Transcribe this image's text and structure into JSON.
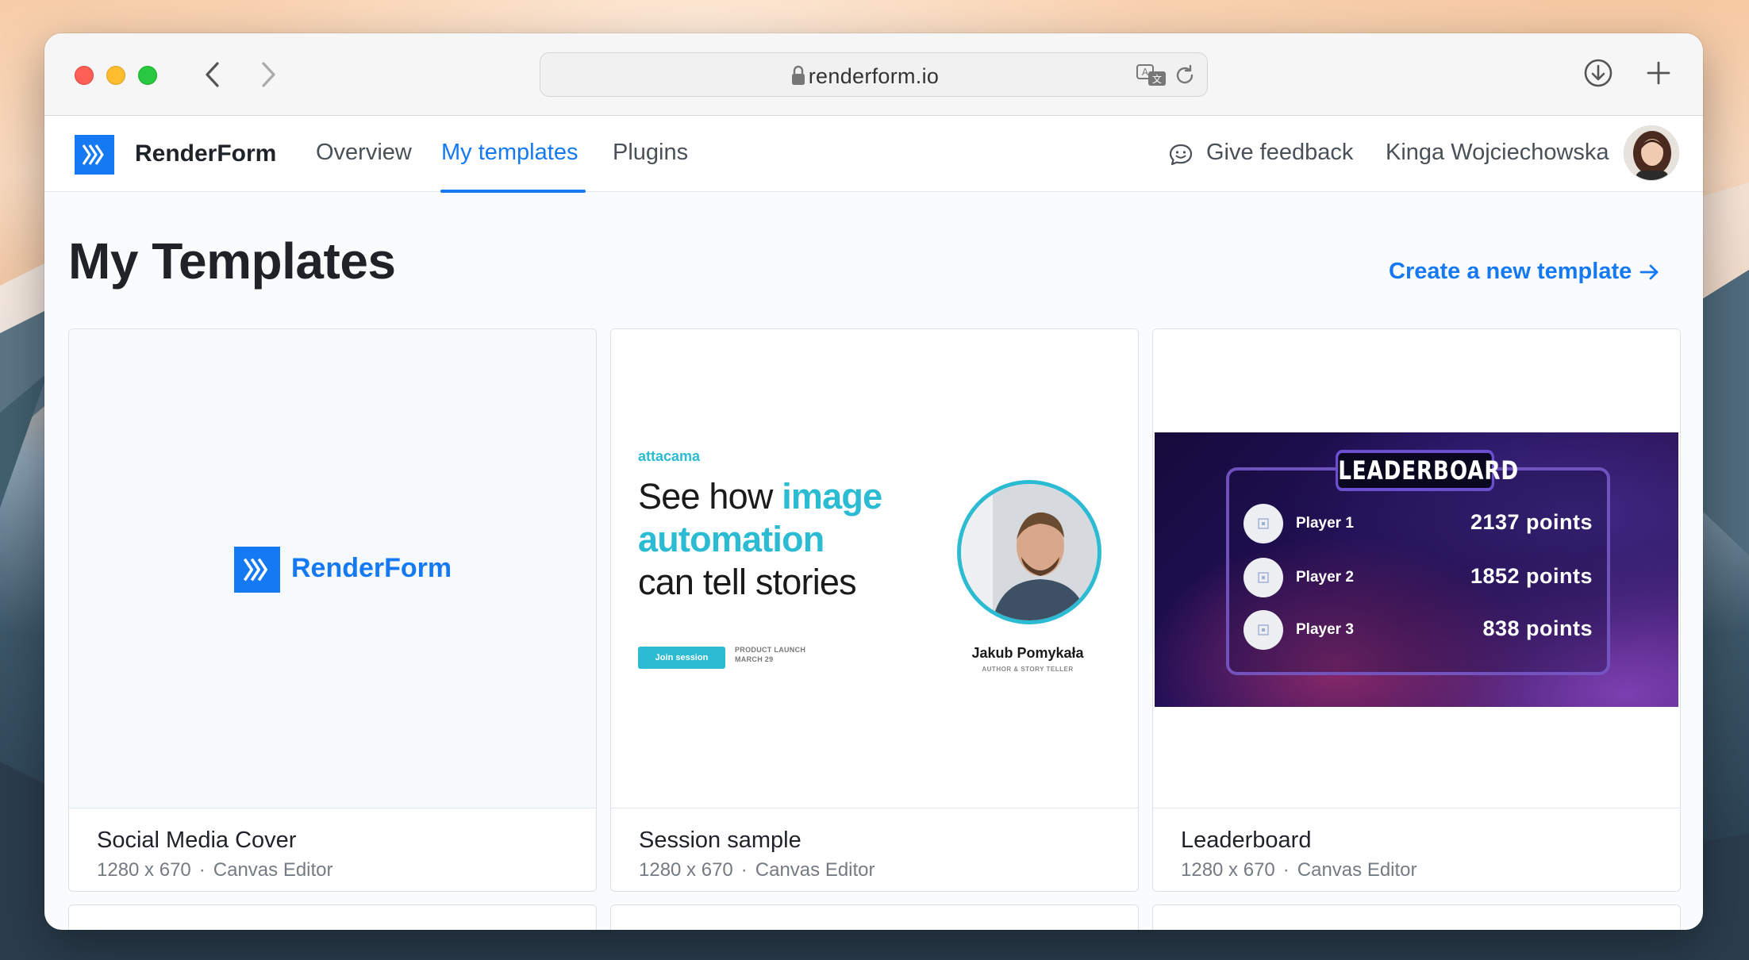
{
  "browser": {
    "url": "renderform.io"
  },
  "app": {
    "brand": "RenderForm",
    "tabs": [
      {
        "label": "Overview",
        "active": false
      },
      {
        "label": "My templates",
        "active": true
      },
      {
        "label": "Plugins",
        "active": false
      }
    ],
    "feedback_label": "Give feedback",
    "user_name": "Kinga Wojciechowska",
    "accent_color": "#1479f2"
  },
  "page": {
    "title": "My Templates",
    "create_link": "Create a new template"
  },
  "templates": [
    {
      "name": "Social Media Cover",
      "size": "1280 x 670",
      "editor": "Canvas Editor",
      "preview": {
        "brand": "RenderForm"
      }
    },
    {
      "name": "Session sample",
      "size": "1280 x 670",
      "editor": "Canvas Editor",
      "preview": {
        "brand": "attacama",
        "headline_pre": "See how ",
        "headline_hl1": "image",
        "headline_hl2": "automation",
        "headline_post": "can tell stories",
        "button": "Join session",
        "event_line1": "PRODUCT LAUNCH",
        "event_line2": "MARCH 29",
        "person": "Jakub Pomykała",
        "role": "AUTHOR & STORY TELLER",
        "highlight_color": "#2bbbd3"
      }
    },
    {
      "name": "Leaderboard",
      "size": "1280 x 670",
      "editor": "Canvas Editor",
      "preview": {
        "title": "LEADERBOARD",
        "rows": [
          {
            "player": "Player 1",
            "points": "2137 points"
          },
          {
            "player": "Player 2",
            "points": "1852 points"
          },
          {
            "player": "Player 3",
            "points": "838 points"
          }
        ]
      }
    }
  ]
}
